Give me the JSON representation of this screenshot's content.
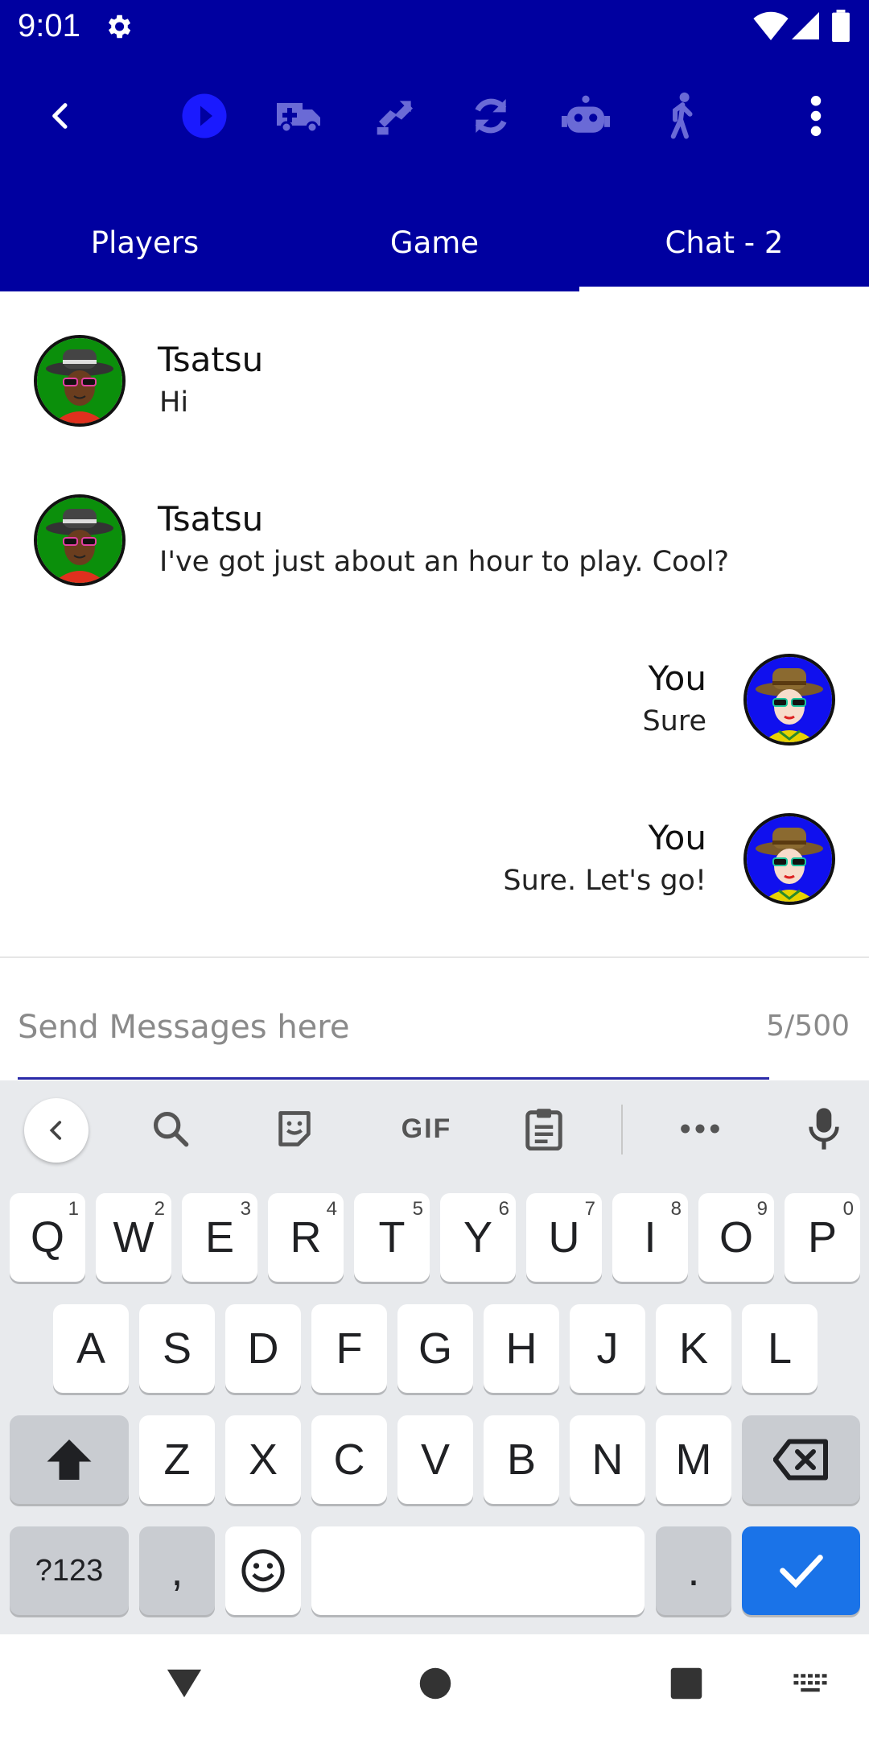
{
  "status_bar": {
    "time": "9:01"
  },
  "tabs": [
    {
      "label": "Players"
    },
    {
      "label": "Game"
    },
    {
      "label": "Chat - 2",
      "active": true
    }
  ],
  "messages": [
    {
      "author": "Tsatsu",
      "text": "Hi",
      "side": "incoming"
    },
    {
      "author": "Tsatsu",
      "text": "I've got just about an hour to play. Cool?",
      "side": "incoming"
    },
    {
      "author": "You",
      "text": "Sure",
      "side": "outgoing"
    },
    {
      "author": "You",
      "text": "Sure. Let's go!",
      "side": "outgoing"
    }
  ],
  "compose": {
    "placeholder": "Send Messages here",
    "value": "",
    "counter": "5/500"
  },
  "keyboard": {
    "suggestion_gif": "GIF",
    "row1": [
      {
        "k": "Q",
        "h": "1"
      },
      {
        "k": "W",
        "h": "2"
      },
      {
        "k": "E",
        "h": "3"
      },
      {
        "k": "R",
        "h": "4"
      },
      {
        "k": "T",
        "h": "5"
      },
      {
        "k": "Y",
        "h": "6"
      },
      {
        "k": "U",
        "h": "7"
      },
      {
        "k": "I",
        "h": "8"
      },
      {
        "k": "O",
        "h": "9"
      },
      {
        "k": "P",
        "h": "0"
      }
    ],
    "row2": [
      "A",
      "S",
      "D",
      "F",
      "G",
      "H",
      "J",
      "K",
      "L"
    ],
    "row3": [
      "Z",
      "X",
      "C",
      "V",
      "B",
      "N",
      "M"
    ],
    "symbols_label": "?123",
    "comma_label": ",",
    "period_label": "."
  },
  "colors": {
    "app_bar": "#0000a0",
    "accent_blue": "#1a73e8",
    "play_button": "#1a1aff"
  }
}
